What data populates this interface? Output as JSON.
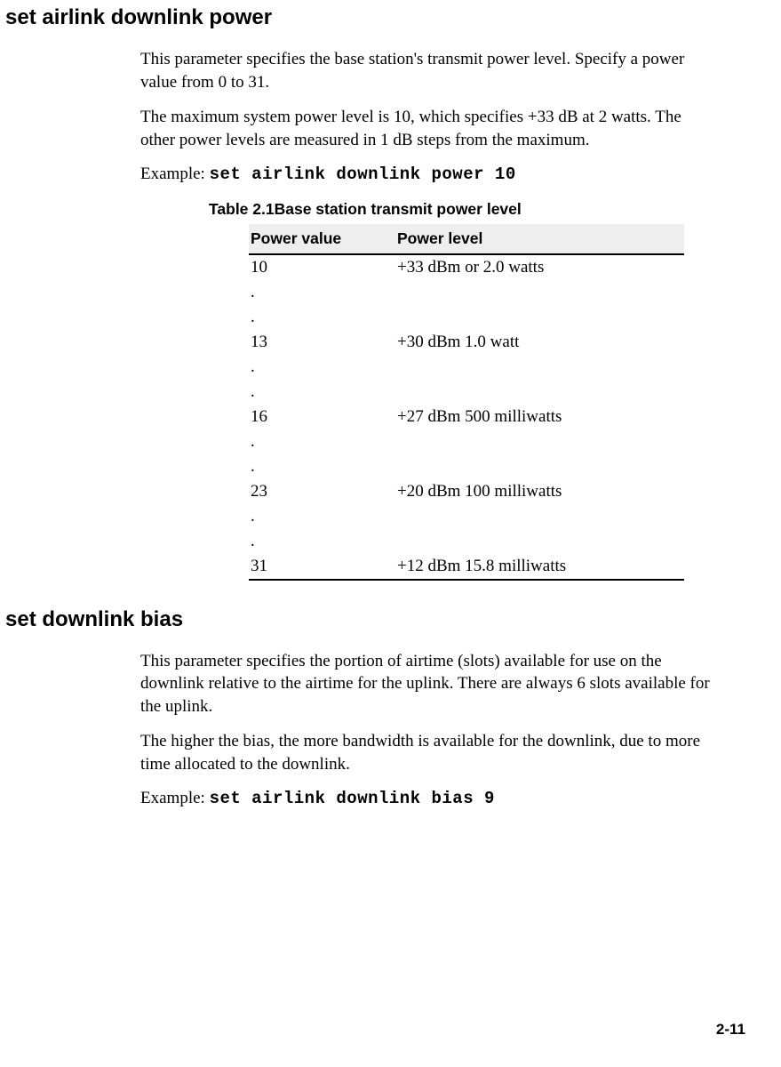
{
  "section1": {
    "heading": "set airlink downlink power",
    "para1": "This parameter specifies the base station's transmit power level. Specify a power value from 0 to 31.",
    "para2": "The maximum system power level is 10, which specifies +33 dB at 2 watts. The other power levels are measured in 1 dB steps from the maximum.",
    "example_label": "Example: ",
    "example_code": "set airlink downlink power 10"
  },
  "table": {
    "caption_label": "Table 2.1",
    "caption_title": "Base station transmit power level",
    "header1": "Power value",
    "header2": "Power level",
    "rows": [
      {
        "c1": "10",
        "c2": "+33 dBm or 2.0 watts"
      },
      {
        "c1": ".",
        "c2": ""
      },
      {
        "c1": ".",
        "c2": ""
      },
      {
        "c1": "13",
        "c2": "+30 dBm 1.0 watt"
      },
      {
        "c1": ".",
        "c2": ""
      },
      {
        "c1": ".",
        "c2": ""
      },
      {
        "c1": "16",
        "c2": "+27 dBm 500 milliwatts"
      },
      {
        "c1": ".",
        "c2": ""
      },
      {
        "c1": ".",
        "c2": ""
      },
      {
        "c1": "23",
        "c2": "+20 dBm 100 milliwatts"
      },
      {
        "c1": ".",
        "c2": ""
      },
      {
        "c1": ".",
        "c2": ""
      },
      {
        "c1": "31",
        "c2": "+12 dBm 15.8 milliwatts"
      }
    ]
  },
  "section2": {
    "heading": "set downlink bias",
    "para1": "This parameter specifies the portion of airtime (slots) available for use on the downlink relative to the airtime for the uplink. There are always 6 slots available for the uplink.",
    "para2": "The higher the bias, the more bandwidth is available for the downlink, due to more time allocated to the downlink.",
    "example_label": "Example: ",
    "example_code": "set airlink downlink bias 9"
  },
  "page_number": "2-11",
  "chart_data": {
    "type": "table",
    "title": "Base station transmit power level",
    "columns": [
      "Power value",
      "Power level"
    ],
    "rows": [
      [
        "10",
        "+33 dBm or 2.0 watts"
      ],
      [
        "13",
        "+30 dBm 1.0 watt"
      ],
      [
        "16",
        "+27 dBm 500 milliwatts"
      ],
      [
        "23",
        "+20 dBm 100 milliwatts"
      ],
      [
        "31",
        "+12 dBm 15.8 milliwatts"
      ]
    ]
  }
}
